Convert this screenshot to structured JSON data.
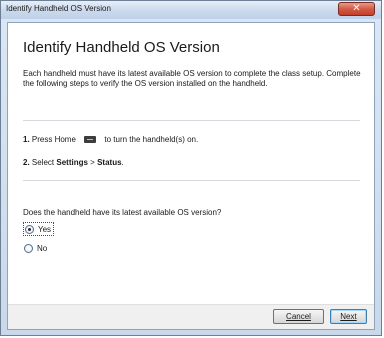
{
  "window": {
    "title": "Identify Handheld OS Version",
    "close_glyph": "✕"
  },
  "main": {
    "heading": "Identify Handheld OS Version",
    "intro": "Each handheld must have its latest available OS version to complete the class setup. Complete the following steps to verify the OS version installed on the handheld.",
    "steps": [
      {
        "number": "1.",
        "text_before": "Press Home",
        "icon": "home-key-icon",
        "text_after": "to turn the handheld(s) on."
      },
      {
        "number": "2.",
        "text_before": "Select",
        "bold1": "Settings",
        "separator": ">",
        "bold2": "Status",
        "text_after": "."
      }
    ],
    "question": "Does the handheld have its latest available OS version?",
    "options": [
      {
        "label": "Yes",
        "selected": true
      },
      {
        "label": "No",
        "selected": false
      }
    ]
  },
  "footer": {
    "cancel_label": "Cancel",
    "next_label": "Next"
  }
}
